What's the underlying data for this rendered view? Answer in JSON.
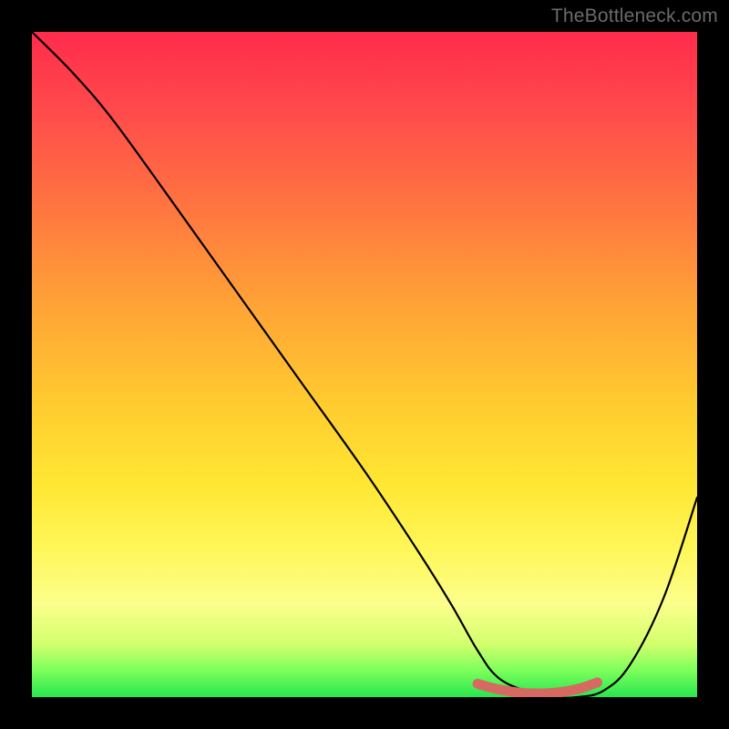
{
  "watermark": "TheBottleneck.com",
  "chart_data": {
    "type": "line",
    "title": "",
    "xlabel": "",
    "ylabel": "",
    "xlim": [
      0,
      100
    ],
    "ylim": [
      0,
      100
    ],
    "series": [
      {
        "name": "bottleneck-curve",
        "x": [
          0,
          6,
          12,
          20,
          30,
          40,
          50,
          58,
          63,
          67,
          70,
          74,
          78,
          82,
          86,
          90,
          95,
          100
        ],
        "values": [
          100,
          94,
          87,
          76,
          62,
          48,
          34,
          22,
          14,
          7,
          3,
          1,
          0,
          0,
          1,
          5,
          15,
          30
        ]
      },
      {
        "name": "minimum-highlight",
        "x": [
          67,
          70,
          74,
          78,
          82,
          85
        ],
        "values": [
          2,
          1.2,
          0.6,
          0.6,
          1.2,
          2.2
        ]
      }
    ],
    "colors": {
      "curve": "#000000",
      "highlight": "#d66a63"
    },
    "annotations": []
  }
}
